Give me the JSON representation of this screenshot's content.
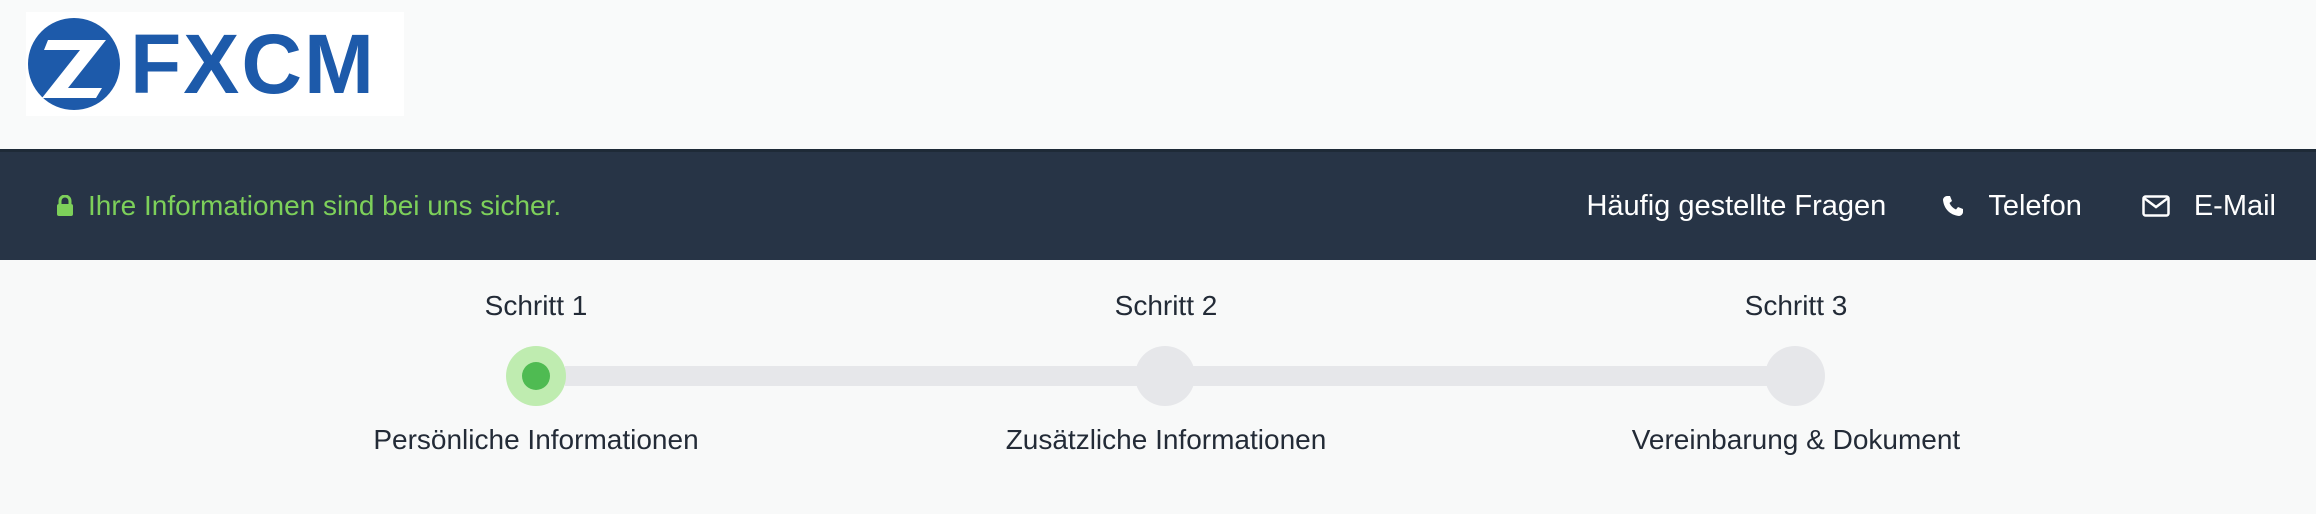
{
  "brand": {
    "logo_text": "FXCM",
    "logo_color": "#1d5aaa"
  },
  "infobar": {
    "secure_text": "Ihre Informationen sind bei uns sicher.",
    "faq_label": "Häufig gestellte Fragen",
    "phone_label": "Telefon",
    "email_label": "E-Mail"
  },
  "steps": [
    {
      "title": "Schritt 1",
      "label": "Persönliche Informationen",
      "active": true
    },
    {
      "title": "Schritt 2",
      "label": "Zusätzliche Informationen",
      "active": false
    },
    {
      "title": "Schritt 3",
      "label": "Vereinbarung & Dokument",
      "active": false
    }
  ],
  "colors": {
    "bar_bg": "#273446",
    "secure_green": "#7dd05a",
    "active_dot": "#4fbb52",
    "active_halo": "#bfecb0",
    "inactive": "#e6e7ea"
  }
}
